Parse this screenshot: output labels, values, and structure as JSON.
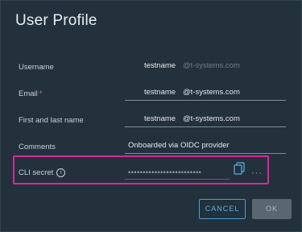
{
  "dialog": {
    "title": "User Profile"
  },
  "fields": {
    "username": {
      "label": "Username",
      "prefix": "testname",
      "domain": "@t-systems.com"
    },
    "email": {
      "label": "Email",
      "required": "*",
      "prefix": "testname",
      "domain": "@t-systems.com"
    },
    "name": {
      "label": "First and last name",
      "prefix": "testname",
      "domain": "@t-systems.com"
    },
    "comments": {
      "label": "Comments",
      "value": "Onboarded via OIDC provider"
    },
    "cli_secret": {
      "label": "CLI secret",
      "info": "i",
      "value": "•••••••••••••••••••••••••",
      "more": "···"
    }
  },
  "buttons": {
    "cancel": "CANCEL",
    "ok": "OK"
  },
  "colors": {
    "highlight": "#d52a9c",
    "accent": "#4a9fd1"
  }
}
